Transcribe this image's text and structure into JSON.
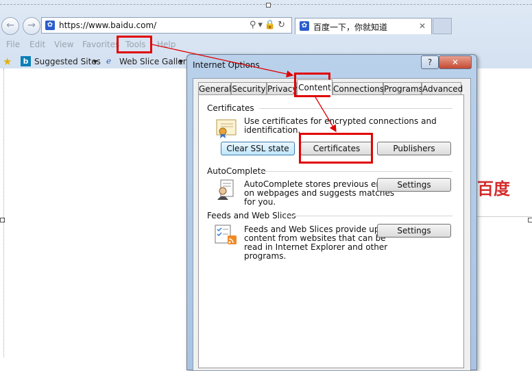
{
  "browser": {
    "url": "https://www.baidu.com/",
    "tab_title": "百度一下，你就知道",
    "tab_close": "✕",
    "menu": [
      "File",
      "Edit",
      "View",
      "Favorites",
      "Tools",
      "Help"
    ],
    "favorites": {
      "suggested_sites": "Suggested Sites",
      "dropdown_arrow": "▾",
      "web_slice_gallery": "Web Slice Gallery"
    },
    "page_logo_text": "百度"
  },
  "dialog": {
    "title": "Internet Options",
    "help_label": "?",
    "close_label": "✕",
    "tabs": [
      "General",
      "Security",
      "Privacy",
      "Content",
      "Connections",
      "Programs",
      "Advanced"
    ],
    "active_tab": "Content",
    "certificates": {
      "title": "Certificates",
      "description": "Use certificates for encrypted connections and identification.",
      "buttons": {
        "clear_ssl": "Clear SSL state",
        "certificates": "Certificates",
        "publishers": "Publishers"
      }
    },
    "autocomplete": {
      "title": "AutoComplete",
      "description_lines": [
        "AutoComplete stores previous entries",
        "on webpages and suggests matches",
        "for you."
      ],
      "settings_label": "Settings"
    },
    "feeds": {
      "title": "Feeds and Web Slices",
      "description_lines": [
        "Feeds and Web Slices provide updated",
        "content from websites that can be",
        "read in Internet Explorer and other",
        "programs."
      ],
      "settings_label": "Settings"
    }
  },
  "colors": {
    "annotation_red": "#e00000",
    "chrome_blue": "#d4e1f1",
    "baidu_red": "#d42c2c"
  },
  "icons": [
    "back-arrow-icon",
    "forward-arrow-icon",
    "baidu-paw-icon",
    "search-icon",
    "lock-icon",
    "refresh-icon",
    "favorites-star-icon",
    "bing-icon",
    "web-slice-icon",
    "certificate-icon",
    "autocomplete-icon",
    "feeds-icon"
  ]
}
